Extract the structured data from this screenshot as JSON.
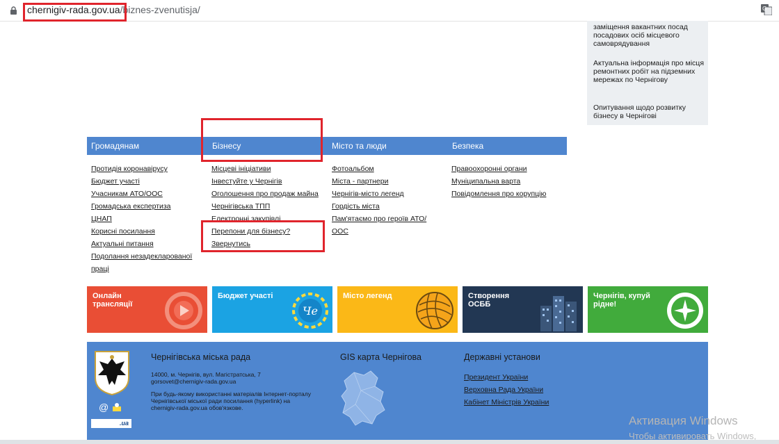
{
  "browser": {
    "url_host": "chernigiv-rada.gov.ua",
    "url_path": "/biznes-zvenutisja/"
  },
  "news": [
    "заміщення вакантних посад посадових осіб місцевого самоврядування",
    "Актуальна інформація про місця ремонтних робіт на підземних мережах по Чернігову",
    "Опитування щодо розвитку бізнесу в Чернігові"
  ],
  "menu": {
    "headers": [
      "Громадянам",
      "Бізнесу",
      "Місто та люди",
      "Безпека"
    ],
    "citizens": [
      "Протидія коронавірусу",
      "Бюджет участі",
      "Учасникам АТО/ООС",
      "Громадська експертиза",
      "ЦНАП",
      "Корисні посилання",
      "Актуальні питання",
      "Подолання незадекларованої",
      "праці"
    ],
    "business": [
      "Місцеві ініціативи",
      "Інвестуйте у Чернігів",
      "Оголошення про продаж майна",
      "Чернігівська ТПП",
      "Електронні закупівлі",
      "Перепони для бізнесу?",
      "Звернутись"
    ],
    "city": [
      "Фотоальбом",
      "Міста - партнери",
      "Чернігів-місто легенд",
      "Гордість міста",
      "Пам'ятаємо про героїв АТО/",
      "ООС"
    ],
    "safety": [
      "Правоохоронні органи",
      "Муніципальна варта",
      "Повідомлення про корупцію"
    ]
  },
  "tiles": [
    {
      "l1": "Онлайн",
      "l2": "трансляції",
      "color": "#e94e35"
    },
    {
      "l1": "Бюджет участі",
      "l2": "",
      "color": "#1ba3e3"
    },
    {
      "l1": "Місто легенд",
      "l2": "",
      "color": "#fbb817"
    },
    {
      "l1": "Створення",
      "l2": "ОСББ",
      "color": "#223753"
    },
    {
      "l1": "Чернігів, купуй",
      "l2": "рідне!",
      "color": "#41ab3c"
    }
  ],
  "tile_badge_che": "Че",
  "footer": {
    "org": "Чернігівська міська рада",
    "address": "14000, м. Чернігів, вул. Магістратська, 7",
    "email": "gorsovet@chernigiv-rada.gov.ua",
    "note1": "При будь-якому використанні матеріалів Інтернет-порталу",
    "note2": "Чернігівської міської ради посилання (hyperlink) на",
    "note3": "chernigiv-rada.gov.ua обов'язкове.",
    "gis": "GIS карта Чернігова",
    "gov_title": "Державні установи",
    "gov": [
      "Президент України",
      "Верховна Рада України",
      "Кабінет Міністрів України"
    ],
    "at_symbol": "@",
    "badge_ua": ".ua"
  },
  "watermark": {
    "line1": "Активация Windows",
    "line2": "Чтобы активировать Windows,"
  },
  "colors": {
    "menu_blue": "#4f86cf",
    "highlight_red": "#e0242c",
    "news_bg": "#eceff2"
  }
}
